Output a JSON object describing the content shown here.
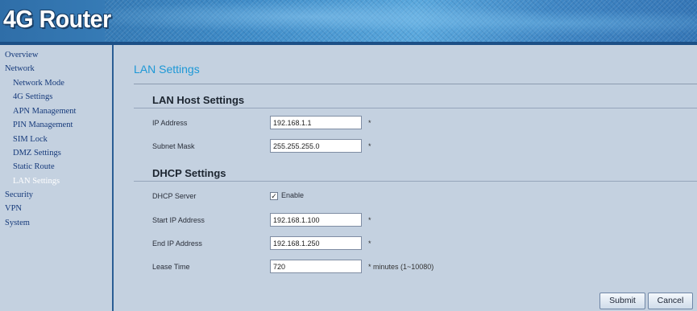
{
  "header": {
    "logo_text": "4G Router"
  },
  "sidebar": {
    "items": [
      {
        "label": "Overview"
      },
      {
        "label": "Network"
      },
      {
        "label": "Network Mode"
      },
      {
        "label": "4G Settings"
      },
      {
        "label": "APN Management"
      },
      {
        "label": "PIN Management"
      },
      {
        "label": "SIM Lock"
      },
      {
        "label": "DMZ Settings"
      },
      {
        "label": "Static Route"
      },
      {
        "label": "LAN Settings"
      },
      {
        "label": "Security"
      },
      {
        "label": "VPN"
      },
      {
        "label": "System"
      }
    ],
    "active": "LAN Settings"
  },
  "page": {
    "title": "LAN Settings"
  },
  "lan_host": {
    "title": "LAN Host Settings",
    "ip_label": "IP Address",
    "ip_value": "192.168.1.1",
    "mask_label": "Subnet Mask",
    "mask_value": "255.255.255.0",
    "required_mark": "*"
  },
  "dhcp": {
    "title": "DHCP Settings",
    "server_label": "DHCP Server",
    "enable_label": "Enable",
    "enabled": true,
    "check_glyph": "✓",
    "start_label": "Start IP Address",
    "start_value": "192.168.1.100",
    "end_label": "End IP Address",
    "end_value": "192.168.1.250",
    "lease_label": "Lease Time",
    "lease_value": "720",
    "lease_unit": "* minutes (1~10080)",
    "required_mark": "*"
  },
  "buttons": {
    "submit": "Submit",
    "cancel": "Cancel"
  },
  "colors": {
    "accent": "#1d98d6",
    "background": "#c4d1e0",
    "nav_text": "#15397a",
    "header_blue": "#3f8cc8"
  }
}
